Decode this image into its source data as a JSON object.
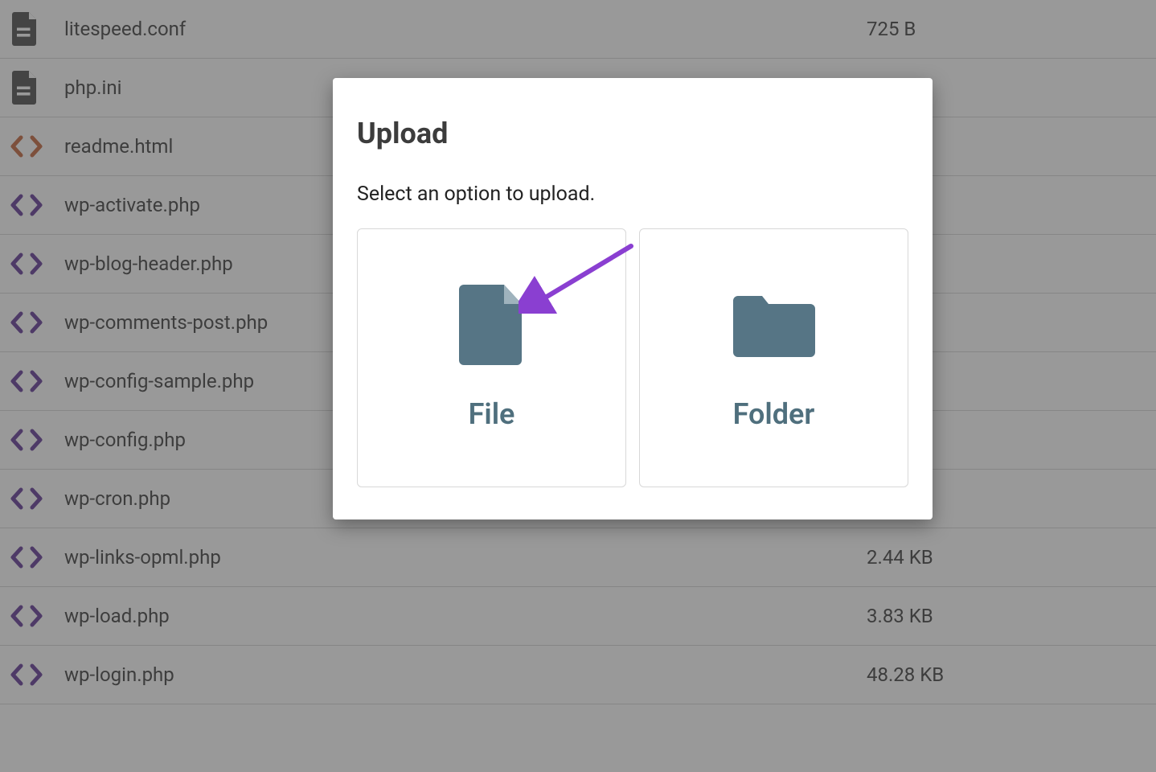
{
  "files": [
    {
      "icon": "doc",
      "name": "litespeed.conf",
      "size": "725 B"
    },
    {
      "icon": "doc",
      "name": "php.ini",
      "size": ""
    },
    {
      "icon": "html",
      "name": "readme.html",
      "size": ""
    },
    {
      "icon": "code",
      "name": "wp-activate.php",
      "size": ""
    },
    {
      "icon": "code",
      "name": "wp-blog-header.php",
      "size": ""
    },
    {
      "icon": "code",
      "name": "wp-comments-post.php",
      "size": ""
    },
    {
      "icon": "code",
      "name": "wp-config-sample.php",
      "size": ""
    },
    {
      "icon": "code",
      "name": "wp-config.php",
      "size": ""
    },
    {
      "icon": "code",
      "name": "wp-cron.php",
      "size": ""
    },
    {
      "icon": "code",
      "name": "wp-links-opml.php",
      "size": "2.44 KB"
    },
    {
      "icon": "code",
      "name": "wp-load.php",
      "size": "3.83 KB"
    },
    {
      "icon": "code",
      "name": "wp-login.php",
      "size": "48.28 KB"
    }
  ],
  "dialog": {
    "title": "Upload",
    "subtitle": "Select an option to upload.",
    "option_file": "File",
    "option_folder": "Folder"
  }
}
